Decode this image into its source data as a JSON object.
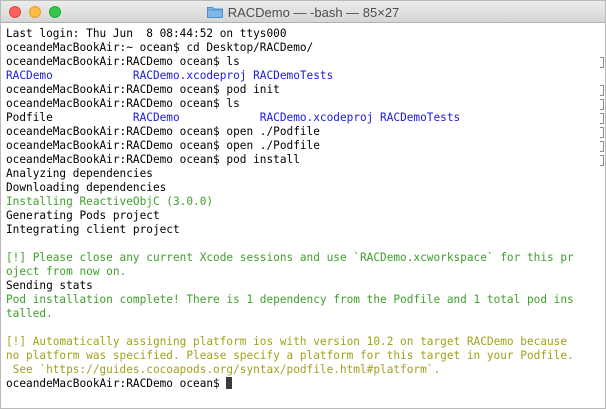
{
  "window": {
    "title": "RACDemo — -bash — 85×27",
    "icon": "folder-icon"
  },
  "terminal": {
    "lines": [
      {
        "segments": [
          {
            "text": "Last login: Thu Jun  8 08:44:52 on ttys000",
            "style": "plain"
          }
        ]
      },
      {
        "segments": [
          {
            "text": "oceandeMacBookAir:~ ocean$ cd Desktop/RACDemo/",
            "style": "plain"
          }
        ]
      },
      {
        "segments": [
          {
            "text": "oceandeMacBookAir:RACDemo ocean$ ls",
            "style": "plain"
          }
        ]
      },
      {
        "segments": [
          {
            "text": "RACDemo            RACDemo.xcodeproj RACDemoTests",
            "style": "blue"
          }
        ]
      },
      {
        "segments": [
          {
            "text": "oceandeMacBookAir:RACDemo ocean$ pod init",
            "style": "plain"
          }
        ]
      },
      {
        "segments": [
          {
            "text": "oceandeMacBookAir:RACDemo ocean$ ls",
            "style": "plain"
          }
        ]
      },
      {
        "segments": [
          {
            "text": "Podfile            ",
            "style": "plain"
          },
          {
            "text": "RACDemo            RACDemo.xcodeproj RACDemoTests",
            "style": "blue"
          }
        ]
      },
      {
        "segments": [
          {
            "text": "oceandeMacBookAir:RACDemo ocean$ open ./Podfile",
            "style": "plain"
          }
        ]
      },
      {
        "segments": [
          {
            "text": "oceandeMacBookAir:RACDemo ocean$ open ./Podfile",
            "style": "plain"
          }
        ]
      },
      {
        "segments": [
          {
            "text": "oceandeMacBookAir:RACDemo ocean$ pod install",
            "style": "plain"
          }
        ]
      },
      {
        "segments": [
          {
            "text": "Analyzing dependencies",
            "style": "plain"
          }
        ]
      },
      {
        "segments": [
          {
            "text": "Downloading dependencies",
            "style": "plain"
          }
        ]
      },
      {
        "segments": [
          {
            "text": "Installing ReactiveObjC (3.0.0)",
            "style": "green"
          }
        ]
      },
      {
        "segments": [
          {
            "text": "Generating Pods project",
            "style": "plain"
          }
        ]
      },
      {
        "segments": [
          {
            "text": "Integrating client project",
            "style": "plain"
          }
        ]
      },
      {
        "segments": [
          {
            "text": "",
            "style": "plain"
          }
        ]
      },
      {
        "segments": [
          {
            "text": "[!] Please close any current Xcode sessions and use `RACDemo.xcworkspace` for this pr",
            "style": "green"
          }
        ]
      },
      {
        "segments": [
          {
            "text": "oject from now on.",
            "style": "green"
          }
        ]
      },
      {
        "segments": [
          {
            "text": "Sending stats",
            "style": "plain"
          }
        ]
      },
      {
        "segments": [
          {
            "text": "Pod installation complete! There is 1 dependency from the Podfile and 1 total pod ins",
            "style": "green"
          }
        ]
      },
      {
        "segments": [
          {
            "text": "talled.",
            "style": "green"
          }
        ]
      },
      {
        "segments": [
          {
            "text": "",
            "style": "plain"
          }
        ]
      },
      {
        "segments": [
          {
            "text": "[!] Automatically assigning platform ios with version 10.2 on target RACDemo because",
            "style": "yellow"
          }
        ]
      },
      {
        "segments": [
          {
            "text": "no platform was specified. Please specify a platform for this target in your Podfile.",
            "style": "yellow"
          }
        ]
      },
      {
        "segments": [
          {
            "text": " See `https://guides.cocoapods.org/syntax/podfile.html#platform`.",
            "style": "yellow"
          }
        ]
      },
      {
        "segments": [
          {
            "text": "oceandeMacBookAir:RACDemo ocean$ ",
            "style": "plain"
          }
        ],
        "cursor": true
      }
    ]
  },
  "colors": {
    "blue": "#1a1ae0",
    "green": "#3fa02a",
    "yellow": "#a2a11a",
    "close": "#fc605b",
    "minimize": "#fdbc40",
    "maximize": "#34c84a"
  }
}
